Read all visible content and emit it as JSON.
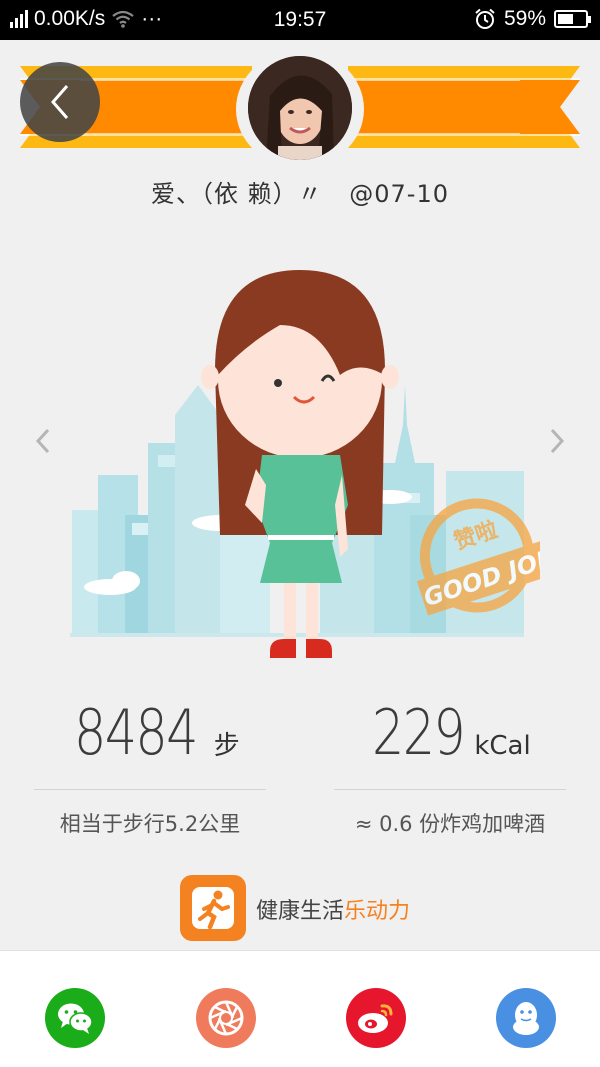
{
  "status_bar": {
    "network_speed": "0.00K/s",
    "more": "···",
    "time": "19:57",
    "battery": "59%",
    "battery_level": 0.59
  },
  "profile": {
    "username": "爱、（依 赖）〃",
    "date": "@07-10"
  },
  "stats": {
    "steps": {
      "value": "8484",
      "unit": "步",
      "description": "相当于步行5.2公里"
    },
    "calories": {
      "value": "229",
      "unit": "kCal",
      "description": "≈ 0.6 份炸鸡加啤酒"
    }
  },
  "stamp": {
    "top_text": "赞啦",
    "bottom_text": "GOOD JOB"
  },
  "brand": {
    "text_main": "健康生活",
    "text_accent": "乐动力"
  },
  "share": [
    {
      "name": "wechat",
      "color": "#1aad19"
    },
    {
      "name": "moments",
      "color": "#f07b5c"
    },
    {
      "name": "weibo",
      "color": "#e6162d"
    },
    {
      "name": "qq",
      "color": "#4a90e2"
    }
  ],
  "colors": {
    "banner_orange": "#ff8a00",
    "banner_yellow": "#fdb813",
    "accent": "#f58220"
  }
}
